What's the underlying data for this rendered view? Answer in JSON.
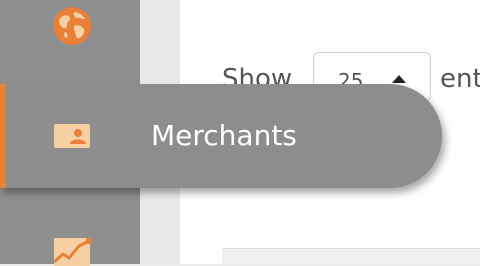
{
  "sidebar": {
    "items": [
      {
        "icon": "globe-icon"
      },
      {
        "icon": "id-card-icon",
        "label": "Merchants",
        "active": true
      },
      {
        "icon": "line-chart-icon"
      }
    ],
    "accent_color": "#e8803a"
  },
  "table_controls": {
    "show_label": "Show",
    "page_length_value": "25",
    "entries_label": "ent"
  }
}
